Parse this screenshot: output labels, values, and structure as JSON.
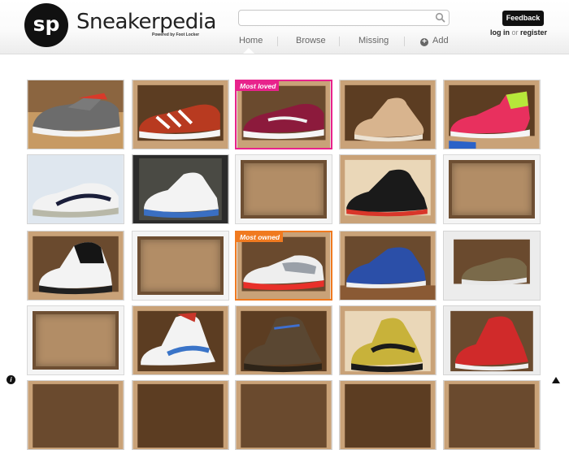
{
  "brand": {
    "logo_text": "sp",
    "name": "Sneakerpedia",
    "tagline": "Powered by Foot Locker"
  },
  "search": {
    "value": "",
    "placeholder": "",
    "icon": "search-icon"
  },
  "nav": {
    "items": [
      {
        "label": "Home",
        "active": true
      },
      {
        "label": "Browse"
      },
      {
        "label": "Missing"
      },
      {
        "label": "Add",
        "icon": "plus-circle-icon"
      }
    ]
  },
  "feedback_label": "Feedback",
  "auth": {
    "login": "log in",
    "or": "or",
    "register": "register"
  },
  "badges": {
    "loved": "Most loved",
    "owned": "Most owned"
  },
  "colors": {
    "loved": "#e8238c",
    "owned": "#f07a20",
    "header_bg": "#f2f2f2"
  },
  "footer": {
    "info_icon": "info-icon",
    "top_icon": "scroll-to-top-icon"
  }
}
